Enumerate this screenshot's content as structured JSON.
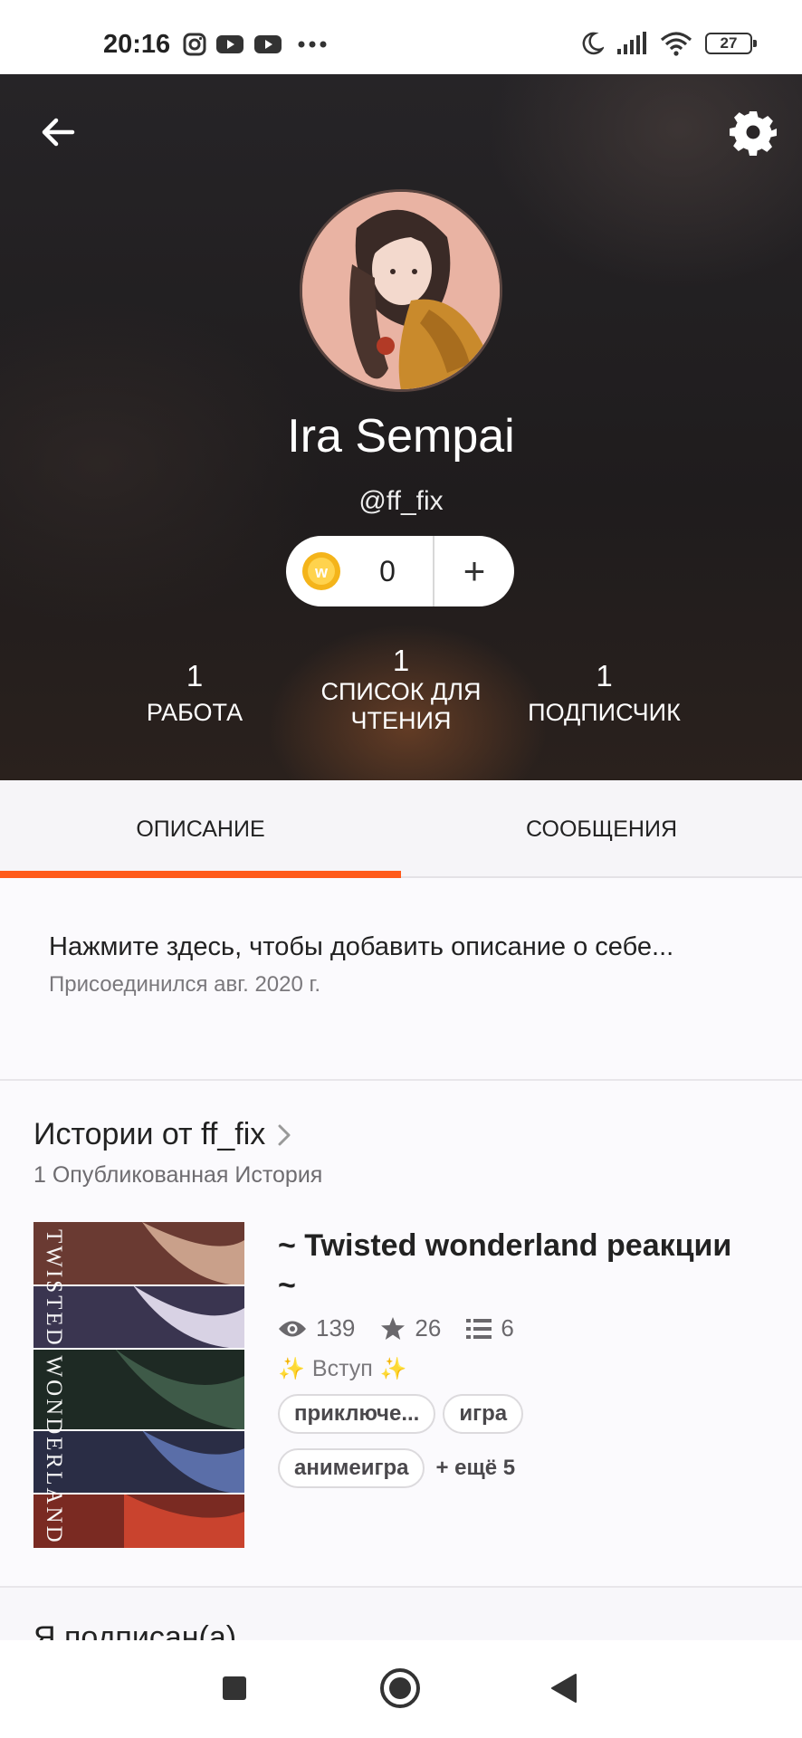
{
  "status_bar": {
    "time": "20:16",
    "left_icons": [
      "instagram-icon",
      "youtube-icon",
      "youtube-icon",
      "more-dots-icon"
    ],
    "right_icons": [
      "moon-icon",
      "signal-icon",
      "wifi-icon"
    ],
    "battery": "27"
  },
  "header": {
    "name": "Ira Sempai",
    "handle": "@ff_fix",
    "coins": "0",
    "coins_add": "+",
    "stats": {
      "works": {
        "value": "1",
        "label": "РАБОТА"
      },
      "reading_lists": {
        "value": "1",
        "label": "СПИСОК ДЛЯ ЧТЕНИЯ"
      },
      "followers": {
        "value": "1",
        "label": "ПОДПИСЧИК"
      }
    }
  },
  "tabs": [
    {
      "label": "ОПИСАНИЕ",
      "active": true
    },
    {
      "label": "СООБЩЕНИЯ",
      "active": false
    }
  ],
  "description": {
    "text": "Нажмите здесь, чтобы добавить описание о себе...",
    "joined": "Присоединился авг. 2020 г."
  },
  "stories": {
    "title": "Истории от ff_fix",
    "subtitle": "1 Опубликованная История",
    "items": [
      {
        "title": "~ Twisted wonderland реакции ~",
        "cover_text": "TWISTED WONDERLAND",
        "reads": "139",
        "votes": "26",
        "parts": "6",
        "part_title": "Вступ",
        "tags": [
          "приключе...",
          "игра",
          "анимеигра"
        ],
        "more_tags": "+ ещё 5"
      }
    ]
  },
  "following": {
    "title": "Я подписан(а)"
  },
  "accent_color": "#ff5a1a"
}
